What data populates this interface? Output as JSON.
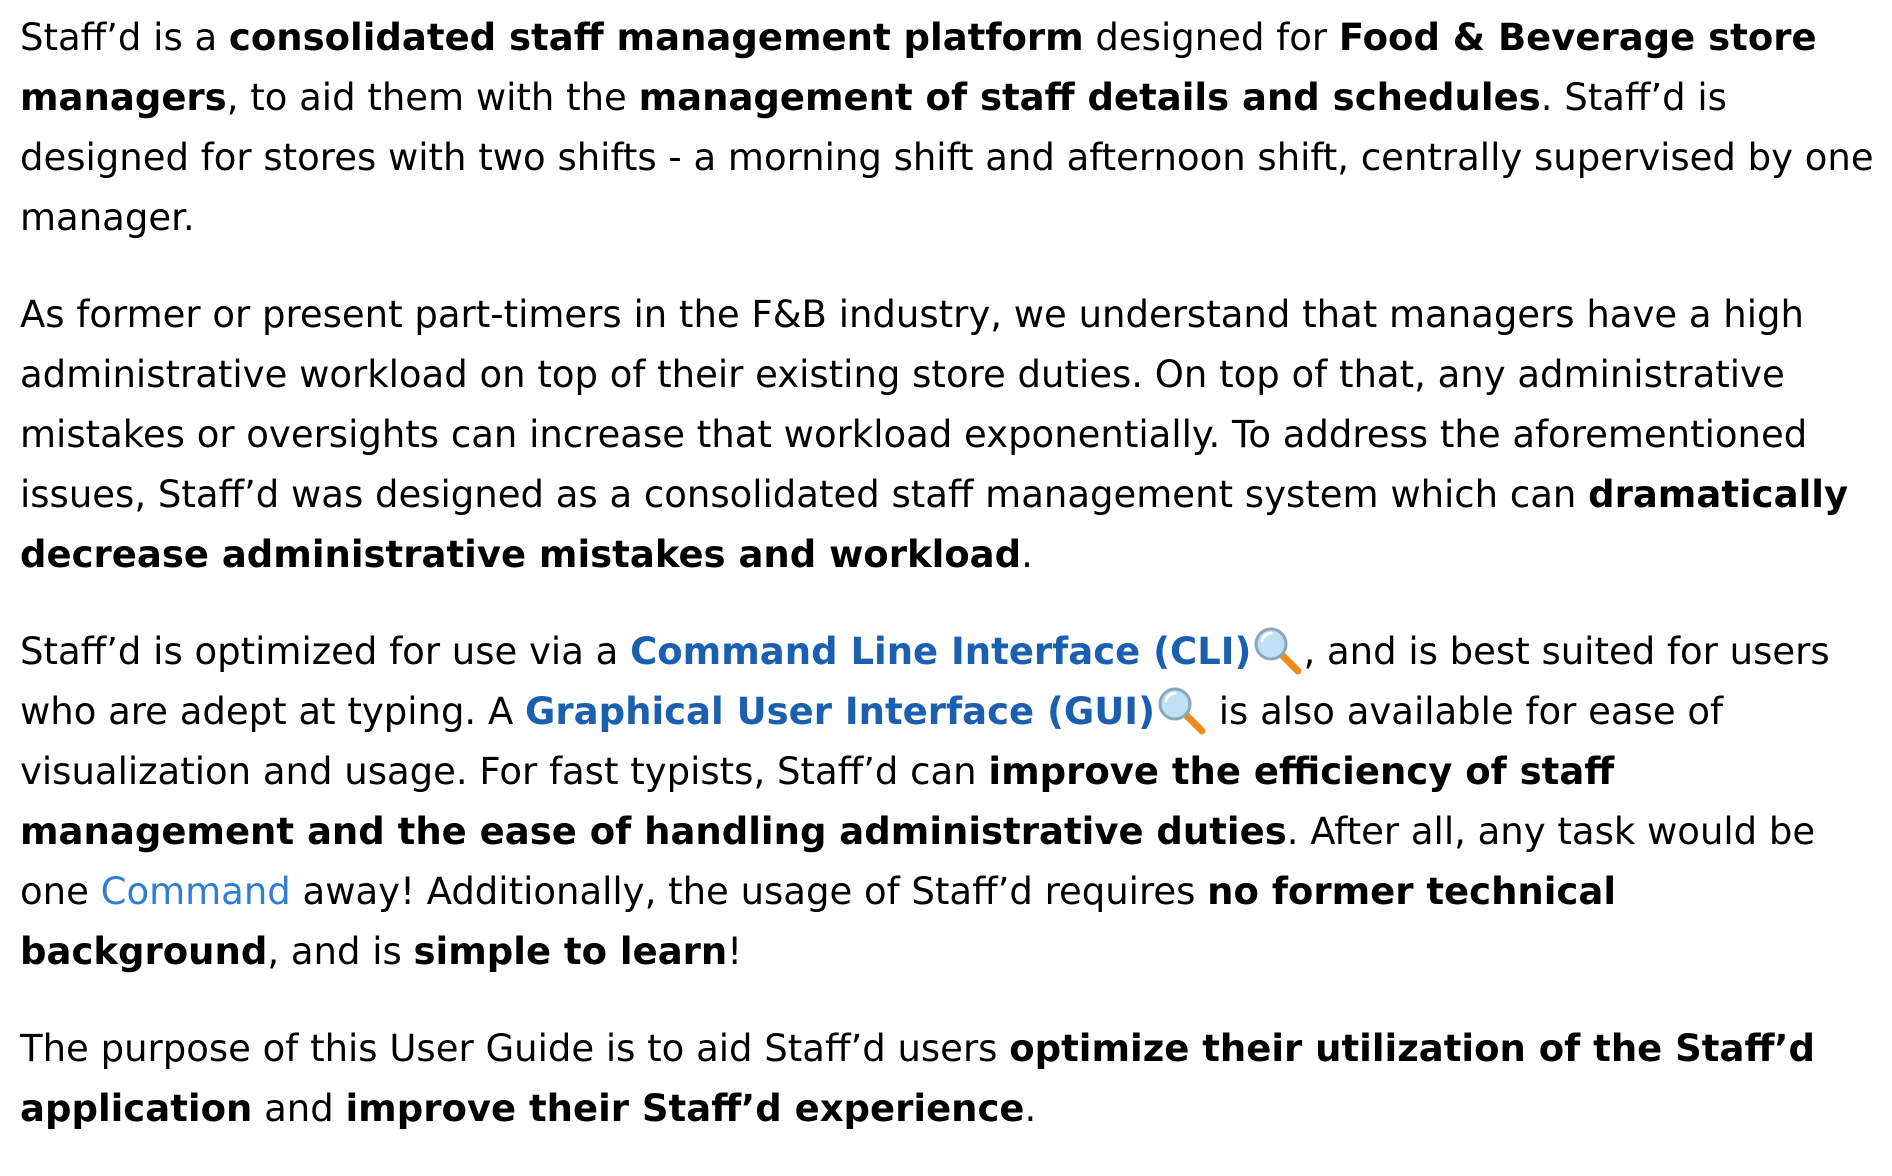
{
  "paragraphs": [
    {
      "segments": [
        {
          "text": "Staff’d is a ",
          "style": "normal"
        },
        {
          "text": "consolidated staff management platform",
          "style": "bold"
        },
        {
          "text": " designed for ",
          "style": "normal"
        },
        {
          "text": "Food & Beverage store managers",
          "style": "bold"
        },
        {
          "text": ", to aid them with the ",
          "style": "normal"
        },
        {
          "text": "management of staff details and schedules",
          "style": "bold"
        },
        {
          "text": ". Staff’d is designed for stores with two shifts - a morning shift and afternoon shift, centrally supervised by one manager.",
          "style": "normal"
        }
      ]
    },
    {
      "segments": [
        {
          "text": "As former or present part-timers in the F&B industry, we understand that managers have a high administrative workload on top of their existing store duties. On top of that, any administrative mistakes or oversights can increase that workload exponentially. To address the aforementioned issues, Staff’d was designed as a consolidated staff management system which can ",
          "style": "normal"
        },
        {
          "text": "dramatically decrease administrative mistakes and workload",
          "style": "bold"
        },
        {
          "text": ".",
          "style": "normal"
        }
      ]
    },
    {
      "segments": [
        {
          "text": "Staff’d is optimized for use via a ",
          "style": "normal"
        },
        {
          "text": "Command Line Interface (CLI)",
          "style": "term",
          "name": "cli-term-link"
        },
        {
          "text": ", and is best suited for users who are adept at typing. A ",
          "style": "normal"
        },
        {
          "text": "Graphical User Interface (GUI)",
          "style": "term",
          "name": "gui-term-link"
        },
        {
          "text": " is also available for ease of visualization and usage. For fast typists, Staff’d can ",
          "style": "normal"
        },
        {
          "text": "improve the efficiency of staff management and the ease of handling administrative duties",
          "style": "bold"
        },
        {
          "text": ". After all, any task would be one ",
          "style": "normal"
        },
        {
          "text": "Command",
          "style": "link",
          "name": "command-link"
        },
        {
          "text": " away! Additionally, the usage of Staff’d requires ",
          "style": "normal"
        },
        {
          "text": "no former technical background",
          "style": "bold"
        },
        {
          "text": ", and is ",
          "style": "normal"
        },
        {
          "text": "simple to learn",
          "style": "bold"
        },
        {
          "text": "!",
          "style": "normal"
        }
      ]
    },
    {
      "segments": [
        {
          "text": "The purpose of this User Guide is to aid Staff’d users ",
          "style": "normal"
        },
        {
          "text": "optimize their utilization of the Staff’d application",
          "style": "bold"
        },
        {
          "text": " and ",
          "style": "normal"
        },
        {
          "text": "improve their Staff’d experience",
          "style": "bold"
        },
        {
          "text": ".",
          "style": "normal"
        }
      ]
    }
  ],
  "icons": {
    "term_marker": "magnifying-glass-icon"
  },
  "colors": {
    "text": "#000000",
    "term_link": "#1b5fb0",
    "plain_link": "#2f7fd1",
    "magnifier_lens": "#bfe0f5",
    "magnifier_rim": "#8aa7bd",
    "magnifier_handle": "#f08a1c"
  }
}
